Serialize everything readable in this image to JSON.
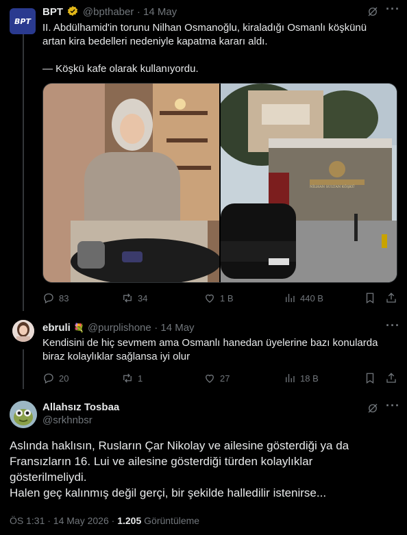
{
  "tweet1": {
    "display_name": "BPT",
    "handle": "@bpthaber",
    "time": "14 May",
    "avatar_text": "BPT",
    "text_line1": "II. Abdülhamid'in torunu Nilhan Osmanoğlu, kiraladığı Osmanlı köşkünü",
    "text_line2": "artan kira bedelleri nedeniyle kapatma kararı aldı.",
    "text_line3": "— Köşkü kafe olarak kullanıyordu.",
    "sign_text": "NİLHAN SULTAN KÖŞKÜ",
    "replies": "83",
    "reposts": "34",
    "likes": "1 B",
    "views": "440 B"
  },
  "tweet2": {
    "display_name": "ebruli",
    "emoji": "💐",
    "handle": "@purplishone",
    "time": "14 May",
    "text_line1": "Kendisini de hiç sevmem ama Osmanlı hanedan üyelerine bazı konularda",
    "text_line2": "biraz kolaylıklar sağlansa iyi olur",
    "replies": "20",
    "reposts": "1",
    "likes": "27",
    "views": "18 B"
  },
  "main_tweet": {
    "display_name": "Allahsız Tosbaa",
    "handle": "@srkhnbsr",
    "text_line1": "Aslında haklısın, Rusların Çar Nikolay ve ailesine gösterdiği ya da",
    "text_line2": "Fransızların 16. Lui ve ailesine gösterdiği türden kolaylıklar",
    "text_line3": "gösterilmeliydi.",
    "text_line4": "Halen geç kalınmış değil gerçi, bir şekilde halledilir istenirse...",
    "time": "ÖS 1:31 · 14 May 2026 ·",
    "views_count": "1.205",
    "views_label": "Görüntüleme"
  },
  "icons": [
    "grok-icon",
    "more-icon",
    "reply-icon",
    "repost-icon",
    "like-icon",
    "views-icon",
    "bookmark-icon",
    "share-icon",
    "verified-icon"
  ],
  "colors": {
    "background": "#000000",
    "text": "#e7e9ea",
    "muted": "#71767b",
    "verified": "#e2b719",
    "border": "#2f3336"
  }
}
